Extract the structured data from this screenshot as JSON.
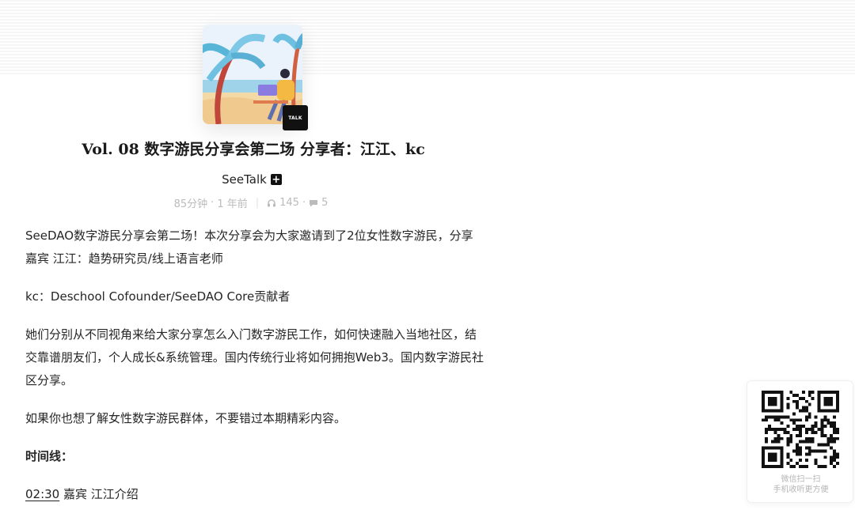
{
  "header": {
    "cover_badge": "TALK"
  },
  "episode": {
    "title": "Vol. 08 数字游民分享会第二场 分享者：江江、kc",
    "podcast_name": "SeeTalk",
    "subscribe_label": "+",
    "duration": "85分钟",
    "published": "1 年前",
    "plays": "145",
    "comments": "5"
  },
  "description": {
    "p1": "SeeDAO数字游民分享会第二场！本次分享会为大家邀请到了2位女性数字游民，分享嘉宾 江江：趋势研究员/线上语言老师",
    "p2": "kc：Deschool Cofounder/SeeDAO Core贡献者",
    "p3": "她们分别从不同视角来给大家分享怎么入门数字游民工作，如何快速融入当地社区，结交靠谱朋友们，个人成长&系统管理。国内传统行业将如何拥抱Web3。国内数字游民社区分享。",
    "p4": "如果你也想了解女性数字游民群体，不要错过本期精彩内容。",
    "timeline_heading": "时间线：",
    "timeline": [
      {
        "time": "02:30",
        "text": " 嘉宾 江江介绍"
      }
    ]
  },
  "qr": {
    "line1": "微信扫一扫",
    "line2": "手机收听更方便"
  },
  "icons": {
    "plays": "headphones-icon",
    "comments": "comment-icon"
  },
  "colors": {
    "meta_text": "#bbbbbb",
    "badge": "#111111"
  }
}
